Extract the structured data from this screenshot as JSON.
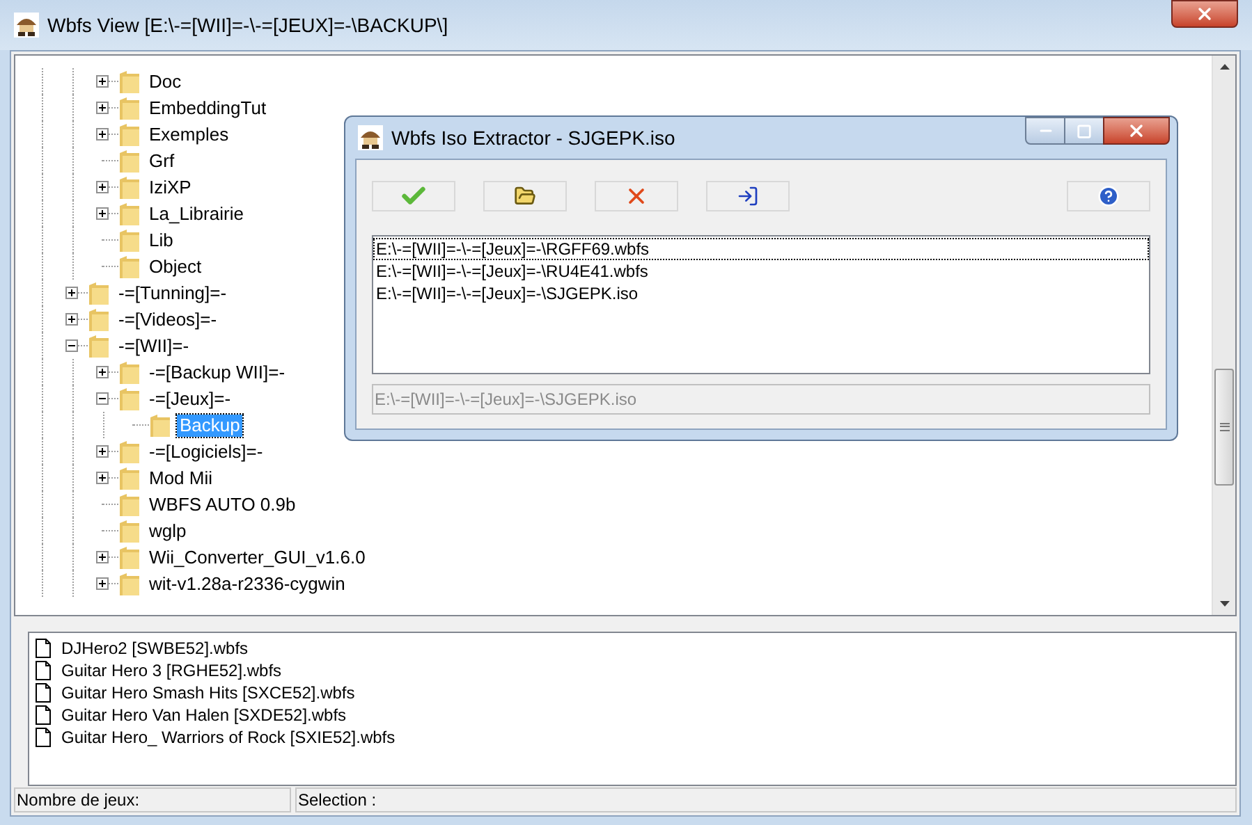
{
  "window": {
    "title": "Wbfs View [E:\\-=[WII]=-\\-=[JEUX]=-\\BACKUP\\]"
  },
  "tree": {
    "continued_items": [
      {
        "label": "Doc",
        "kind": "collapsed",
        "selected": false
      },
      {
        "label": "EmbeddingTut",
        "kind": "collapsed",
        "selected": false
      },
      {
        "label": "Exemples",
        "kind": "collapsed",
        "selected": false
      },
      {
        "label": "Grf",
        "kind": "leaf",
        "selected": false
      },
      {
        "label": "IziXP",
        "kind": "collapsed",
        "selected": false
      },
      {
        "label": "La_Librairie",
        "kind": "collapsed",
        "selected": false
      },
      {
        "label": "Lib",
        "kind": "leaf",
        "selected": false
      },
      {
        "label": "Object",
        "kind": "leaf",
        "selected": false
      }
    ],
    "items": [
      {
        "label": "-=[Tunning]=-",
        "kind": "collapsed",
        "selected": false
      },
      {
        "label": "-=[Videos]=-",
        "kind": "collapsed",
        "selected": false
      },
      {
        "label": "-=[WII]=-",
        "kind": "expanded",
        "selected": false,
        "children": [
          {
            "label": "-=[Backup WII]=-",
            "kind": "collapsed",
            "selected": false
          },
          {
            "label": "-=[Jeux]=-",
            "kind": "expanded",
            "selected": false,
            "children": [
              {
                "label": "Backup",
                "kind": "leaf",
                "selected": true
              }
            ]
          },
          {
            "label": "-=[Logiciels]=-",
            "kind": "collapsed",
            "selected": false
          },
          {
            "label": "Mod Mii",
            "kind": "collapsed",
            "selected": false
          },
          {
            "label": "WBFS AUTO 0.9b",
            "kind": "leaf",
            "selected": false
          },
          {
            "label": "wglp",
            "kind": "leaf",
            "selected": false
          },
          {
            "label": "Wii_Converter_GUI_v1.6.0",
            "kind": "collapsed",
            "selected": false
          },
          {
            "label": "wit-v1.28a-r2336-cygwin",
            "kind": "collapsed",
            "selected": false
          }
        ]
      }
    ]
  },
  "files": [
    "DJHero2 [SWBE52].wbfs",
    "Guitar Hero 3 [RGHE52].wbfs",
    "Guitar Hero Smash Hits [SXCE52].wbfs",
    "Guitar Hero Van Halen [SXDE52].wbfs",
    "Guitar Hero_ Warriors of Rock [SXIE52].wbfs"
  ],
  "status_bar": [
    "Nombre de jeux:",
    "Selection :"
  ],
  "dialog": {
    "title": "Wbfs Iso Extractor - SJGEPK.iso",
    "toolbar": [
      {
        "kind": "confirm"
      },
      {
        "kind": "open"
      },
      {
        "kind": "delete"
      },
      {
        "kind": "exit"
      },
      {
        "kind": "help"
      }
    ],
    "list": [
      {
        "path": "E:\\-=[WII]=-\\-=[Jeux]=-\\RGFF69.wbfs",
        "focused": true
      },
      {
        "path": "E:\\-=[WII]=-\\-=[Jeux]=-\\RU4E41.wbfs",
        "focused": false
      },
      {
        "path": "E:\\-=[WII]=-\\-=[Jeux]=-\\SJGEPK.iso",
        "focused": false
      }
    ],
    "field": {
      "value": "E:\\-=[WII]=-\\-=[Jeux]=-\\SJGEPK.iso",
      "disabled": true
    }
  }
}
